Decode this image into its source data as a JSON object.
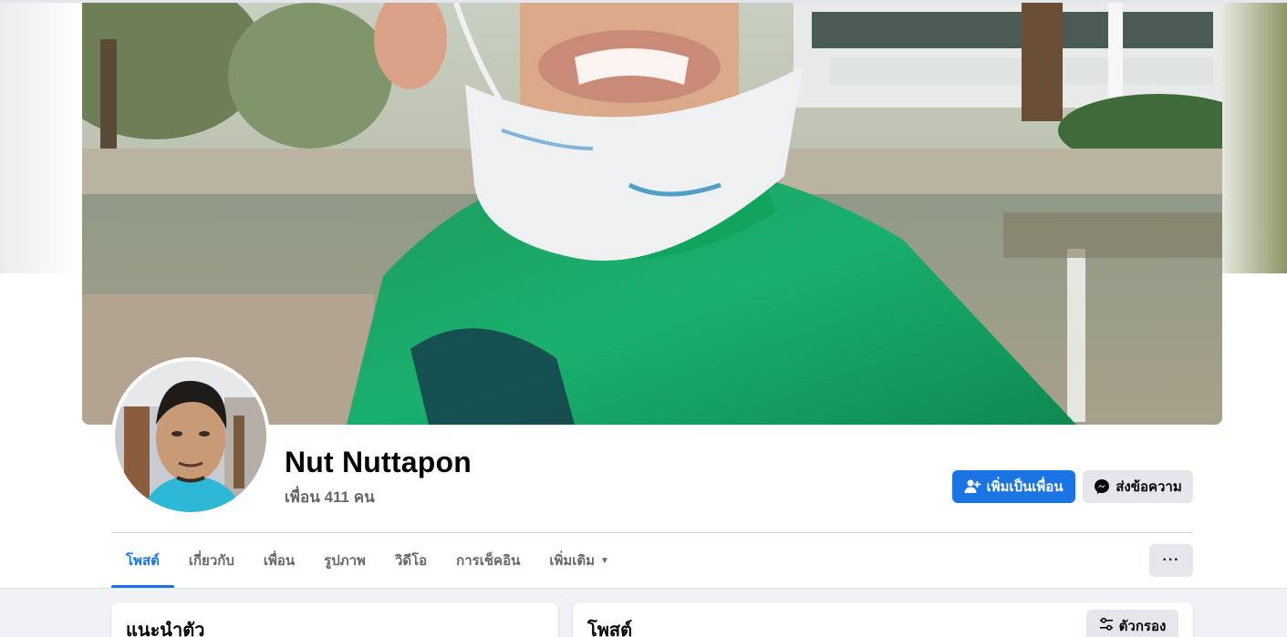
{
  "profile": {
    "name": "Nut Nuttapon",
    "friends_count": "เพื่อน 411 คน"
  },
  "actions": {
    "add_friend_label": "เพิ่มเป็นเพื่อน",
    "message_label": "ส่งข้อความ",
    "more_label": "···"
  },
  "tabs": [
    {
      "label": "โพสต์",
      "active": true
    },
    {
      "label": "เกี่ยวกับ",
      "active": false
    },
    {
      "label": "เพื่อน",
      "active": false
    },
    {
      "label": "รูปภาพ",
      "active": false
    },
    {
      "label": "วิดีโอ",
      "active": false
    },
    {
      "label": "การเช็คอิน",
      "active": false
    },
    {
      "label": "เพิ่มเติม",
      "active": false,
      "has_caret": true
    }
  ],
  "intro_card": {
    "title": "แนะนำตัว"
  },
  "posts_card": {
    "title": "โพสต์",
    "filter_label": "ตัวกรอง"
  },
  "colors": {
    "accent": "#1b74e4",
    "secondary_button": "#e4e6eb",
    "muted_text": "#65676b",
    "page_bg": "#f0f2f5"
  }
}
